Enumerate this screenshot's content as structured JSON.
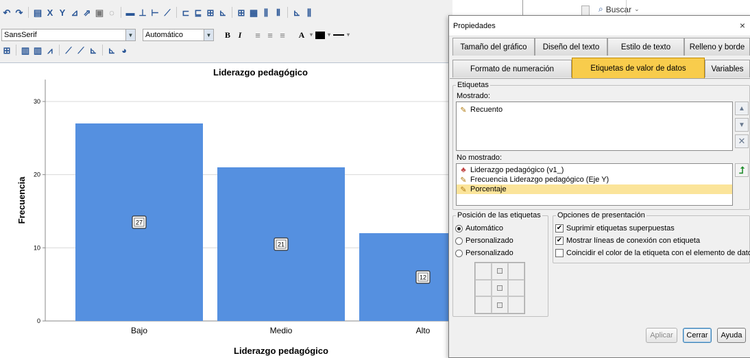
{
  "toolbar": {
    "font_name": "SansSerif",
    "font_size": "Automático",
    "bold": "B",
    "italic": "I",
    "text_color": "A"
  },
  "chart_data": {
    "type": "bar",
    "title": "Liderazgo pedagógico",
    "xlabel": "Liderazgo pedagógico",
    "ylabel": "Frecuencia",
    "categories": [
      "Bajo",
      "Medio",
      "Alto"
    ],
    "values": [
      27,
      21,
      12
    ],
    "data_labels": [
      "27",
      "21",
      "12"
    ],
    "ylim": [
      0,
      33
    ],
    "yticks": [
      "0",
      "10",
      "20",
      "30"
    ],
    "bar_color": "#5590e0",
    "grid": true
  },
  "background_window": {
    "search_label": "Buscar"
  },
  "dialog": {
    "title": "Propiedades",
    "close": "×",
    "tabs_row1": [
      "Tamaño del gráfico",
      "Diseño del texto",
      "Estilo de texto",
      "Relleno y borde"
    ],
    "tabs_row2": [
      "Formato de numeración",
      "Etiquetas de valor de datos",
      "Variables"
    ],
    "labels_group": "Etiquetas",
    "shown_label": "Mostrado:",
    "shown_items": [
      "Recuento"
    ],
    "hidden_label": "No mostrado:",
    "hidden_items": [
      "Liderazgo pedagógico (v1_)",
      "Frecuencia Liderazgo pedagógico (Eje Y)",
      "Porcentaje"
    ],
    "position_group": "Posición de las etiquetas",
    "position_options": [
      "Automático",
      "Personalizado",
      "Personalizado"
    ],
    "display_group": "Opciones de presentación",
    "display_options": [
      {
        "label": "Suprimir etiquetas superpuestas",
        "checked": true
      },
      {
        "label": "Mostrar líneas de conexión con etiqueta",
        "checked": true
      },
      {
        "label": "Coincidir el color de la etiqueta con el elemento de datos",
        "checked": false
      }
    ],
    "apply": "Aplicar",
    "close_btn": "Cerrar",
    "help": "Ayuda"
  }
}
